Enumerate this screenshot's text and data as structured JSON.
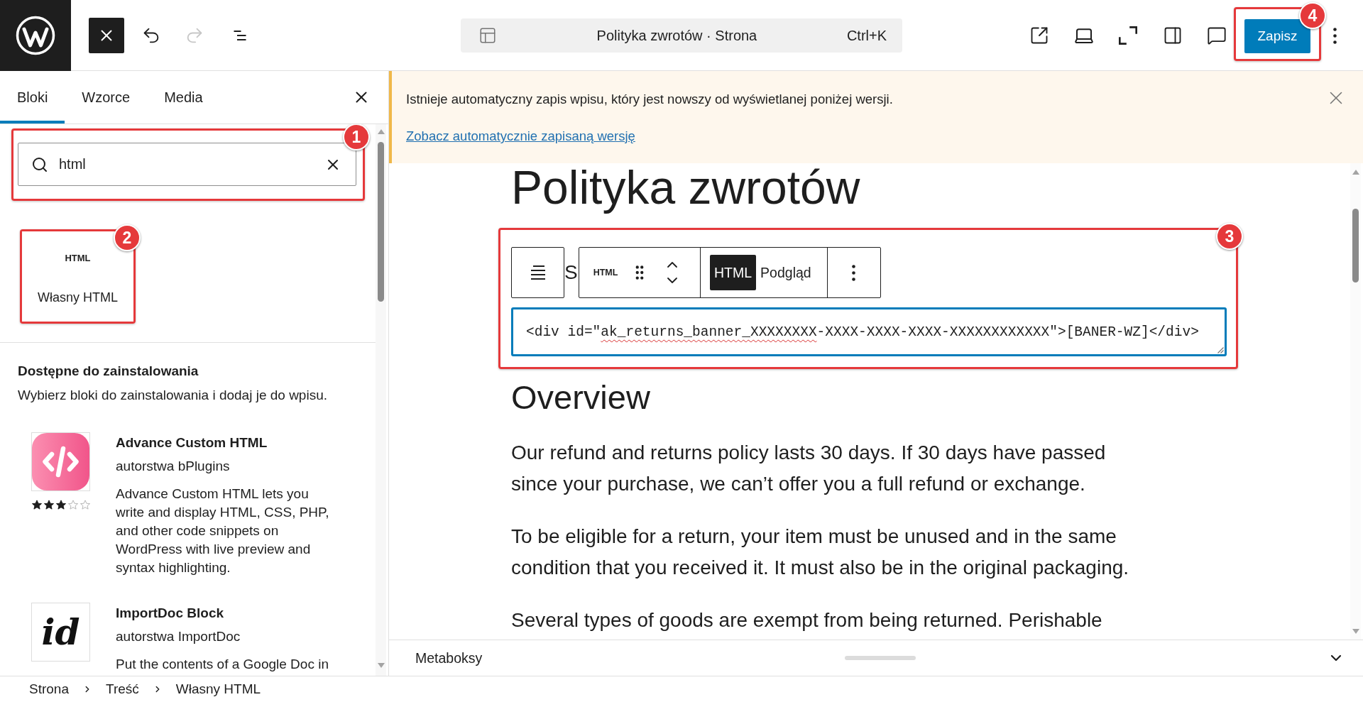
{
  "top_bar": {
    "history": [
      {
        "kind": "undo",
        "disabled": false
      },
      {
        "kind": "redo",
        "disabled": true
      }
    ],
    "document_title": "Polityka zwrotów · Strona",
    "shortcut": "Ctrl+K",
    "save_button": {
      "label": "Zapisz",
      "callout": "4"
    }
  },
  "inserter": {
    "tabs": [
      {
        "label": "Bloki",
        "selected": true
      },
      {
        "label": "Wzorce",
        "selected": false
      },
      {
        "label": "Media",
        "selected": false
      }
    ],
    "search": {
      "value": "html",
      "callout": "1"
    },
    "results": [
      {
        "icon_label": "HTML",
        "title": "Własny HTML",
        "callout": "2"
      }
    ],
    "directory": {
      "heading": "Dostępne do zainstalowania",
      "description": "Wybierz bloki do zainstalowania i dodaj je do wpisu.",
      "plugins": [
        {
          "kind": "code",
          "title": "Advance Custom HTML",
          "author": "autorstwa bPlugins",
          "stars": 3,
          "description": [
            "Advance Custom HTML lets you",
            "write and display HTML, CSS, PHP,",
            "and other code snippets on",
            "WordPress with live preview and",
            "syntax highlighting."
          ]
        },
        {
          "kind": "monogram",
          "icon_label": "id",
          "title": "ImportDoc Block",
          "author": "autorstwa ImportDoc",
          "description": [
            "Put the contents of a Google Doc in"
          ]
        }
      ]
    }
  },
  "notice": {
    "message": "Istnieje automatyczny zapis wpisu, który jest nowszy od wyświetlanej poniżej wersji.",
    "link": "Zobacz automatycznie zapisaną wersję"
  },
  "canvas": {
    "title": "Polityka zwrotów",
    "html_block": {
      "callout": "3",
      "paragraph_fragment": "S",
      "block_icon_label": "HTML",
      "modes": [
        {
          "label": "HTML",
          "selected": true
        },
        {
          "label": "Podgląd",
          "selected": false
        }
      ],
      "code": [
        {
          "text": "<div id=\"",
          "misspelled": false
        },
        {
          "text": "ak_returns_banner_XXXXXXXX",
          "misspelled": true
        },
        {
          "text": "-XXXX-XXXX-XXXX-XXXXXXXXXXXX\">[BANER-WZ]</div>",
          "misspelled": false
        }
      ]
    },
    "blocks": [
      {
        "kind": "heading",
        "lines": [
          "Overview"
        ]
      },
      {
        "kind": "paragraph",
        "lines": [
          "Our refund and returns policy lasts 30 days. If 30 days have passed",
          "since your purchase, we can’t offer you a full refund or exchange."
        ]
      },
      {
        "kind": "paragraph",
        "lines": [
          "To be eligible for a return, your item must be unused and in the same",
          "condition that you received it. It must also be in the original packaging."
        ]
      },
      {
        "kind": "paragraph",
        "lines": [
          "Several types of goods are exempt from being returned. Perishable"
        ]
      }
    ]
  },
  "metaboxes": {
    "title": "Metaboksy",
    "expanded": false
  },
  "breadcrumbs": [
    "Strona",
    "Treść",
    "Własny HTML"
  ]
}
